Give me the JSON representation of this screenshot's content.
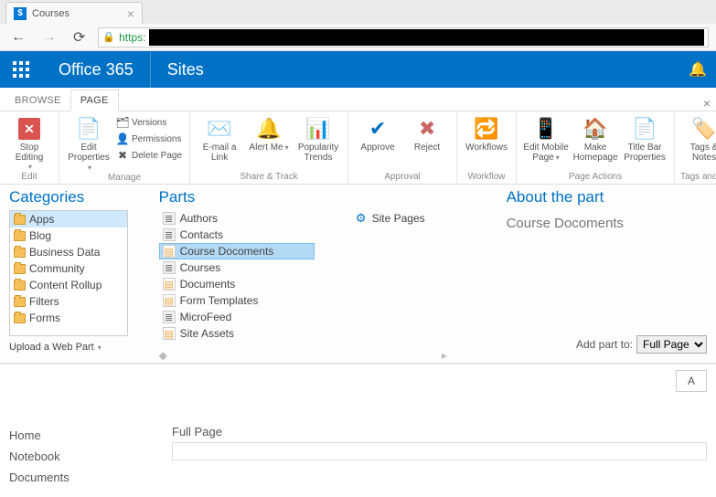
{
  "browser": {
    "tab_title": "Courses",
    "tab_favicon_letter": "$",
    "url_prefix": "https:"
  },
  "o365": {
    "brand": "Office 365",
    "app_label": "Sites"
  },
  "ribbon": {
    "tabs": [
      "BROWSE",
      "PAGE"
    ],
    "active_tab_index": 1,
    "groups": {
      "edit": {
        "label": "Edit",
        "stop_editing": "Stop Editing"
      },
      "manage": {
        "label": "Manage",
        "edit_properties": "Edit Properties",
        "versions": "Versions",
        "permissions": "Permissions",
        "delete_page": "Delete Page"
      },
      "share_track": {
        "label": "Share & Track",
        "email_link": "E-mail a Link",
        "alert_me": "Alert Me",
        "popularity_trends": "Popularity Trends"
      },
      "approval": {
        "label": "Approval",
        "approve": "Approve",
        "reject": "Reject"
      },
      "workflow": {
        "label": "Workflow",
        "workflows": "Workflows"
      },
      "page_actions": {
        "label": "Page Actions",
        "edit_mobile_page": "Edit Mobile Page",
        "make_homepage": "Make Homepage",
        "title_bar_properties": "Title Bar Properties"
      },
      "tags_notes": {
        "label": "Tags and Notes",
        "tags_notes_btn": "Tags & Notes"
      }
    }
  },
  "gallery": {
    "categories_header": "Categories",
    "categories": [
      {
        "label": "Apps",
        "selected": true
      },
      {
        "label": "Blog",
        "selected": false
      },
      {
        "label": "Business Data",
        "selected": false
      },
      {
        "label": "Community",
        "selected": false
      },
      {
        "label": "Content Rollup",
        "selected": false
      },
      {
        "label": "Filters",
        "selected": false
      },
      {
        "label": "Forms",
        "selected": false
      }
    ],
    "upload_label": "Upload a Web Part",
    "parts_header": "Parts",
    "parts_col1": [
      {
        "label": "Authors",
        "icon": "list",
        "selected": false
      },
      {
        "label": "Contacts",
        "icon": "list",
        "selected": false
      },
      {
        "label": "Course Docoments",
        "icon": "doclib",
        "selected": true
      },
      {
        "label": "Courses",
        "icon": "list",
        "selected": false
      },
      {
        "label": "Documents",
        "icon": "doclib",
        "selected": false
      },
      {
        "label": "Form Templates",
        "icon": "doclib",
        "selected": false
      },
      {
        "label": "MicroFeed",
        "icon": "list",
        "selected": false
      },
      {
        "label": "Site Assets",
        "icon": "doclib",
        "selected": false
      }
    ],
    "parts_col2": [
      {
        "label": "Site Pages",
        "icon": "gear",
        "selected": false
      }
    ],
    "about_header": "About the part",
    "about_title": "Course Docoments",
    "add_part_to_label": "Add part to:",
    "add_part_to_value": "Full Page"
  },
  "quick_launch": {
    "items": [
      "Home",
      "Notebook",
      "Documents"
    ]
  },
  "page": {
    "zone_label": "Full Page"
  }
}
